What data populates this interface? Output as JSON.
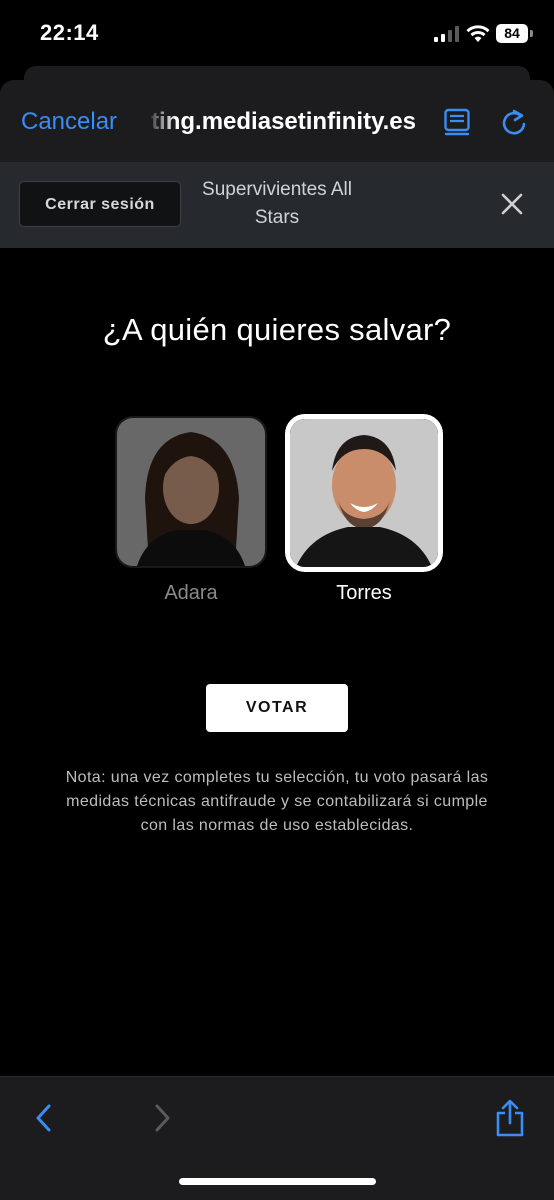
{
  "status_bar": {
    "time": "22:14",
    "battery": "84"
  },
  "browser": {
    "cancel_label": "Cancelar",
    "url": "ting.mediasetinfinity.es",
    "icons": {
      "reader": "reader-view-icon",
      "reload": "reload-icon",
      "back": "chevron-left-icon",
      "forward": "chevron-right-icon",
      "share": "share-icon"
    }
  },
  "header": {
    "logout_label": "Cerrar sesión",
    "show_title": "Supervivientes All Stars",
    "close_icon": "close-icon"
  },
  "poll": {
    "question": "¿A quién quieres salvar?",
    "candidates": [
      {
        "name": "Adara",
        "selected": false
      },
      {
        "name": "Torres",
        "selected": true
      }
    ],
    "vote_label": "VOTAR",
    "note": "Nota: una vez completes tu selección, tu voto pasará las medidas técnicas antifraude y se contabilizará si cumple con las normas de uso establecidas."
  },
  "colors": {
    "accent": "#3a8df5",
    "header_bg": "#262a2f",
    "background": "#000000"
  }
}
